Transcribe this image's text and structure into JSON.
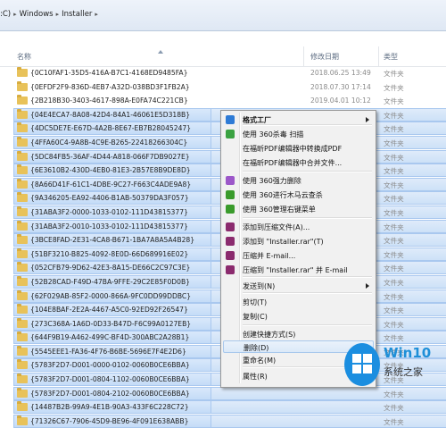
{
  "address": {
    "crumbs": [
      ":C)",
      "Windows",
      "Installer"
    ]
  },
  "columns": {
    "name": "名称",
    "date": "修改日期",
    "type": "类型"
  },
  "rows": [
    {
      "name": "{0C10FAF1-35D5-416A-B7C1-4168ED9485FA}",
      "date": "2018.06.25 13:49",
      "type": "文件夹"
    },
    {
      "name": "{0EFDF2F9-836D-4EB7-A32D-038BD3F1FB2A}",
      "date": "2018.07.30 17:14",
      "type": "文件夹"
    },
    {
      "name": "{2B218B30-3403-4617-898A-E0FA74C221CB}",
      "date": "2019.04.01 10:12",
      "type": "文件夹"
    },
    {
      "name": "{04E4ECA7-8A08-42D4-84A1-46061E5D318B}",
      "date": "",
      "type": "文件夹"
    },
    {
      "name": "{4DC5DE7E-E67D-4A2B-8E67-EB7B28045247}",
      "date": "",
      "type": "文件夹"
    },
    {
      "name": "{4FFA60C4-9A8B-4C9E-B265-22418266304C}",
      "date": "",
      "type": "文件夹"
    },
    {
      "name": "{5DC84FB5-36AF-4D44-A818-066F7DB9027E}",
      "date": "",
      "type": "文件夹"
    },
    {
      "name": "{6E3610B2-430D-4EB0-81E3-2B57E8B9DE8D}",
      "date": "",
      "type": "文件夹"
    },
    {
      "name": "{8A66D41F-61C1-4DBE-9C27-F663C4ADE9A8}",
      "date": "",
      "type": "文件夹"
    },
    {
      "name": "{9A346205-EA92-4406-B1AB-50379DA3F057}",
      "date": "",
      "type": "文件夹"
    },
    {
      "name": "{31ABA3F2-0000-1033-0102-111D43815377}",
      "date": "",
      "type": "文件夹"
    },
    {
      "name": "{31ABA3F2-0010-1033-0102-111D43815377}",
      "date": "",
      "type": "文件夹"
    },
    {
      "name": "{3BCE8FAD-2E31-4CA8-B671-1BA7A8A5A4B28}",
      "date": "",
      "type": "文件夹"
    },
    {
      "name": "{51BF3210-B825-4092-8E0D-66D689916E02}",
      "date": "",
      "type": "文件夹"
    },
    {
      "name": "{052CFB79-9D62-42E3-8A15-DE66C2C97C3E}",
      "date": "",
      "type": "文件夹"
    },
    {
      "name": "{52B28CAD-F49D-47BA-9FFE-29C2E85F0D0B}",
      "date": "",
      "type": "文件夹"
    },
    {
      "name": "{62F029AB-85F2-0000-866A-9FC0DD99DDBC}",
      "date": "",
      "type": "文件夹"
    },
    {
      "name": "{104E8BAF-2E2A-4467-A5C0-92ED92F26547}",
      "date": "",
      "type": "文件夹"
    },
    {
      "name": "{273C368A-1A6D-0D33-B47D-F6C99A0127EB}",
      "date": "",
      "type": "文件夹"
    },
    {
      "name": "{644F9B19-A462-499C-BF4D-300ABC2A28B1}",
      "date": "",
      "type": "文件夹"
    },
    {
      "name": "{5545EEE1-FA36-4F76-B6BE-5696E7F4E2D6}",
      "date": "",
      "type": "文件夹"
    },
    {
      "name": "{5783F2D7-D001-0000-0102-0060B0CE6BBA}",
      "date": "",
      "type": "文件夹"
    },
    {
      "name": "{5783F2D7-D001-0804-1102-0060B0CE6BBA}",
      "date": "",
      "type": "文件夹"
    },
    {
      "name": "{5783F2D7-D001-0804-2102-0060B0CE6BBA}",
      "date": "",
      "type": "文件夹"
    },
    {
      "name": "{14487B2B-99A9-4E1B-90A3-433F6C228C72}",
      "date": "",
      "type": "文件夹"
    },
    {
      "name": "{71326C67-7906-45D9-BE96-4F091E638ABB}",
      "date": "",
      "type": "文件夹"
    }
  ],
  "menu": {
    "items": [
      {
        "label": "格式工厂",
        "icon": "format-factory-icon",
        "color": "#2e7bd6",
        "submenu": true
      },
      {
        "label": "使用 360杀毒 扫描",
        "icon": "shield-icon",
        "color": "#3aa241"
      },
      {
        "label": "在福昕PDF编辑器中转换成PDF",
        "icon": "",
        "color": ""
      },
      {
        "label": "在福昕PDF编辑器中合并文件...",
        "icon": "",
        "color": ""
      },
      {
        "label": "使用 360强力删除",
        "icon": "360-delete-icon",
        "color": "#9c57c9"
      },
      {
        "label": "使用 360进行木马云查杀",
        "icon": "360-trojan-icon",
        "color": "#3a9b2c"
      },
      {
        "label": "使用 360管理右键菜单",
        "icon": "360-menu-icon",
        "color": "#3a9b2c"
      },
      {
        "label": "添加到压缩文件(A)...",
        "icon": "winrar-icon",
        "color": "#8b2b6e"
      },
      {
        "label": "添加到 \"Installer.rar\"(T)",
        "icon": "winrar-icon",
        "color": "#8b2b6e"
      },
      {
        "label": "压缩并 E-mail...",
        "icon": "winrar-icon",
        "color": "#8b2b6e"
      },
      {
        "label": "压缩到 \"Installer.rar\" 并 E-mail",
        "icon": "winrar-icon",
        "color": "#8b2b6e"
      },
      {
        "label": "发送到(N)",
        "icon": "",
        "color": "",
        "submenu": true
      },
      {
        "label": "剪切(T)",
        "icon": "",
        "color": ""
      },
      {
        "label": "复制(C)",
        "icon": "",
        "color": ""
      },
      {
        "label": "创建快捷方式(S)",
        "icon": "",
        "color": ""
      },
      {
        "label": "删除(D)",
        "icon": "",
        "color": ""
      },
      {
        "label": "重命名(M)",
        "icon": "",
        "color": ""
      },
      {
        "label": "属性(R)",
        "icon": "",
        "color": ""
      }
    ]
  },
  "watermark": {
    "title": "Win10",
    "subtitle": "系统之家"
  }
}
